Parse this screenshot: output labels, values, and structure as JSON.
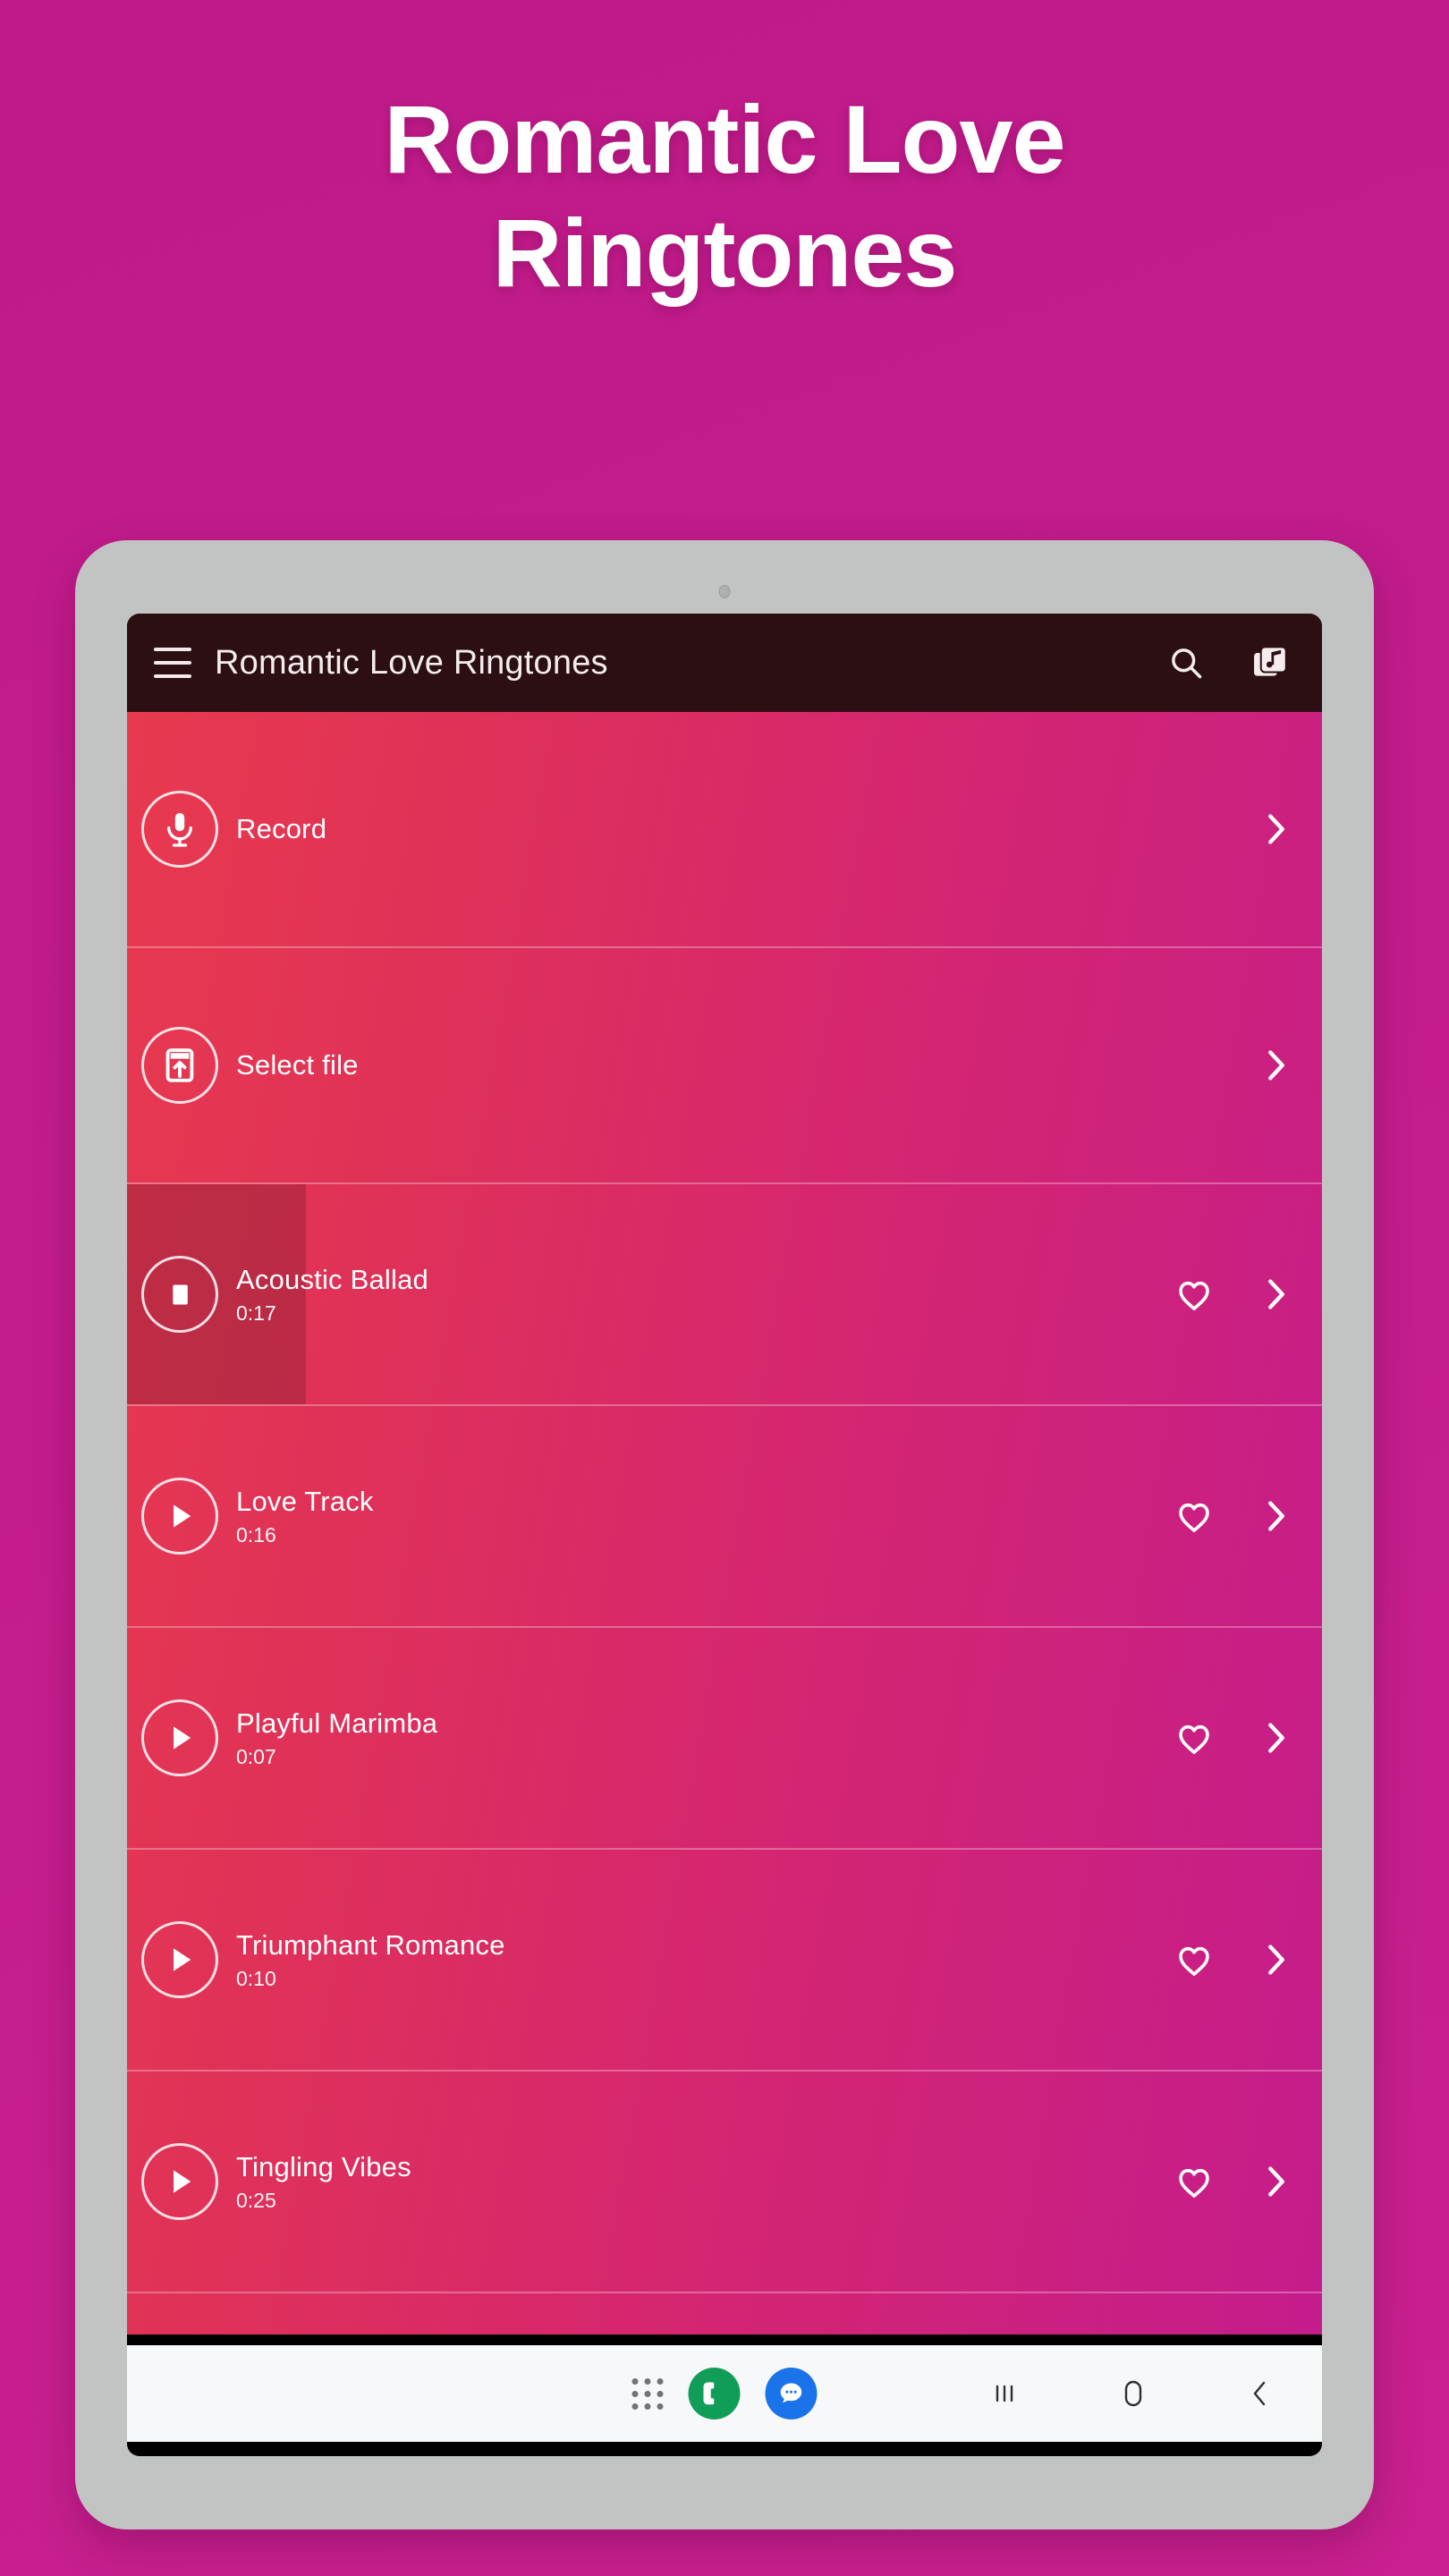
{
  "promo": {
    "title_line1": "Romantic Love",
    "title_line2": "Ringtones"
  },
  "colors": {
    "page_background": "#c41c8c",
    "appbar_background": "#2b0f12",
    "list_gradient_start": "#e8394f",
    "list_gradient_end": "#c41c8c",
    "device_bezel": "#c2c4c3",
    "phone_app": "#0f9d58",
    "messages_app": "#1a73e8"
  },
  "appbar": {
    "menu_icon": "hamburger-menu-icon",
    "title": "Romantic Love Ringtones",
    "search_icon": "search-icon",
    "library_icon": "music-library-icon"
  },
  "actions": [
    {
      "label": "Record",
      "icon": "microphone-icon",
      "chevron": "chevron-right-icon"
    },
    {
      "label": "Select file",
      "icon": "select-file-icon",
      "chevron": "chevron-right-icon"
    }
  ],
  "ringtones": [
    {
      "title": "Acoustic Ballad",
      "duration": "0:17",
      "state": "playing",
      "control_icon": "stop-icon",
      "progress_percent": 15,
      "favorite_icon": "heart-outline-icon",
      "favorited": false,
      "chevron": "chevron-right-icon"
    },
    {
      "title": "Love Track",
      "duration": "0:16",
      "state": "paused",
      "control_icon": "play-icon",
      "progress_percent": 0,
      "favorite_icon": "heart-outline-icon",
      "favorited": false,
      "chevron": "chevron-right-icon"
    },
    {
      "title": "Playful Marimba",
      "duration": "0:07",
      "state": "paused",
      "control_icon": "play-icon",
      "progress_percent": 0,
      "favorite_icon": "heart-outline-icon",
      "favorited": false,
      "chevron": "chevron-right-icon"
    },
    {
      "title": "Triumphant Romance",
      "duration": "0:10",
      "state": "paused",
      "control_icon": "play-icon",
      "progress_percent": 0,
      "favorite_icon": "heart-outline-icon",
      "favorited": false,
      "chevron": "chevron-right-icon"
    },
    {
      "title": "Tingling Vibes",
      "duration": "0:25",
      "state": "paused",
      "control_icon": "play-icon",
      "progress_percent": 0,
      "favorite_icon": "heart-outline-icon",
      "favorited": false,
      "chevron": "chevron-right-icon"
    }
  ],
  "system_bar": {
    "app_drawer_icon": "app-drawer-dots-icon",
    "phone_icon": "phone-icon",
    "messages_icon": "messages-icon",
    "recents_icon": "recents-icon",
    "home_icon": "home-icon",
    "back_icon": "back-icon"
  }
}
